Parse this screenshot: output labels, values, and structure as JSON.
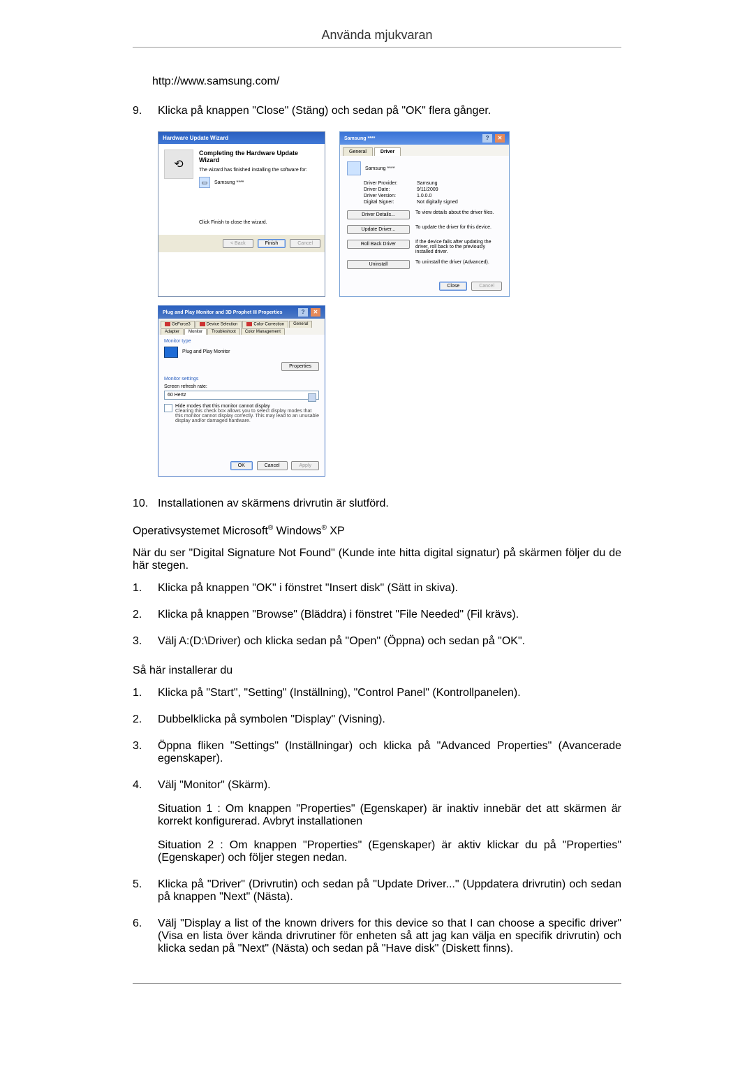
{
  "pageTitle": "Använda mjukvaran",
  "url": "http://www.samsung.com/",
  "step9": {
    "num": "9.",
    "text": "Klicka på knappen \"Close\" (Stäng) och sedan på \"OK\" flera gånger."
  },
  "wiz": {
    "title": "Hardware Update Wizard",
    "heading": "Completing the Hardware Update Wizard",
    "line1": "The wizard has finished installing the software for:",
    "device": "Samsung ****",
    "line2": "Click Finish to close the wizard.",
    "backBtn": "< Back",
    "finishBtn": "Finish",
    "cancelBtn": "Cancel"
  },
  "drv": {
    "title": "Samsung ****",
    "tab1": "General",
    "tab2": "Driver",
    "deviceName": "Samsung ****",
    "fields": {
      "providerLabel": "Driver Provider:",
      "providerVal": "Samsung",
      "dateLabel": "Driver Date:",
      "dateVal": "9/11/2009",
      "versionLabel": "Driver Version:",
      "versionVal": "1.0.0.0",
      "signerLabel": "Digital Signer:",
      "signerVal": "Not digitally signed"
    },
    "btns": {
      "detailsLabel": "Driver Details...",
      "detailsDesc": "To view details about the driver files.",
      "updateLabel": "Update Driver...",
      "updateDesc": "To update the driver for this device.",
      "rollbackLabel": "Roll Back Driver",
      "rollbackDesc": "If the device fails after updating the driver, roll back to the previously installed driver.",
      "uninstallLabel": "Uninstall",
      "uninstallDesc": "To uninstall the driver (Advanced)."
    },
    "closeBtn": "Close",
    "cancelBtn": "Cancel"
  },
  "pnp": {
    "title": "Plug and Play Monitor and 3D Prophet III Properties",
    "tabs": {
      "geforce": "GeForce3",
      "deviceSel": "Device Selection",
      "colorCorr": "Color Correction",
      "general": "General",
      "adapter": "Adapter",
      "monitor": "Monitor",
      "trouble": "Troubleshoot",
      "colorMgmt": "Color Management"
    },
    "monitorType": "Monitor type",
    "monitorName": "Plug and Play Monitor",
    "propsBtn": "Properties",
    "monitorSettings": "Monitor settings",
    "refreshLabel": "Screen refresh rate:",
    "refreshVal": "60 Hertz",
    "hideLabel": "Hide modes that this monitor cannot display",
    "hideDesc": "Clearing this check box allows you to select display modes that this monitor cannot display correctly. This may lead to an unusable display and/or damaged hardware.",
    "okBtn": "OK",
    "cancelBtn": "Cancel",
    "applyBtn": "Apply"
  },
  "step10": {
    "num": "10.",
    "text": "Installationen av skärmens drivrutin är slutförd."
  },
  "osLine": {
    "prefix": "Operativsystemet Microsoft",
    "mid": " Windows",
    "suffix": " XP"
  },
  "dsnf": "När du ser \"Digital Signature Not Found\" (Kunde inte hitta digital signatur) på skärmen följer du de här stegen.",
  "listA": {
    "i1": {
      "n": "1.",
      "t": "Klicka på knappen \"OK\" i fönstret \"Insert disk\" (Sätt in skiva)."
    },
    "i2": {
      "n": "2.",
      "t": "Klicka på knappen \"Browse\" (Bläddra) i fönstret \"File Needed\" (Fil krävs)."
    },
    "i3": {
      "n": "3.",
      "t": "Välj A:(D:\\Driver) och klicka sedan på \"Open\" (Öppna) och sedan på \"OK\"."
    }
  },
  "installHeading": "Så här installerar du",
  "listB": {
    "i1": {
      "n": "1.",
      "t": "Klicka på \"Start\", \"Setting\" (Inställning), \"Control Panel\" (Kontrollpanelen)."
    },
    "i2": {
      "n": "2.",
      "t": "Dubbelklicka på symbolen \"Display\" (Visning)."
    },
    "i3": {
      "n": "3.",
      "t": "Öppna fliken \"Settings\" (Inställningar) och klicka på \"Advanced Properties\" (Avancerade egenskaper)."
    },
    "i4": {
      "n": "4.",
      "t": "Välj \"Monitor\" (Skärm).",
      "s1": "Situation 1 : Om knappen \"Properties\" (Egenskaper) är inaktiv innebär det att skärmen är korrekt konfigurerad. Avbryt installationen",
      "s2": "Situation 2 : Om knappen \"Properties\" (Egenskaper) är aktiv klickar du på \"Properties\" (Egenskaper) och följer stegen nedan."
    },
    "i5": {
      "n": "5.",
      "t": "Klicka på \"Driver\" (Drivrutin) och sedan på \"Update Driver...\" (Uppdatera drivrutin) och sedan på knappen \"Next\" (Nästa)."
    },
    "i6": {
      "n": "6.",
      "t": "Välj \"Display a list of the known drivers for this device so that I can choose a specific driver\" (Visa en lista över kända drivrutiner för enheten så att jag kan välja en specifik drivrutin) och klicka sedan på \"Next\" (Nästa) och sedan på \"Have disk\" (Diskett finns)."
    }
  }
}
